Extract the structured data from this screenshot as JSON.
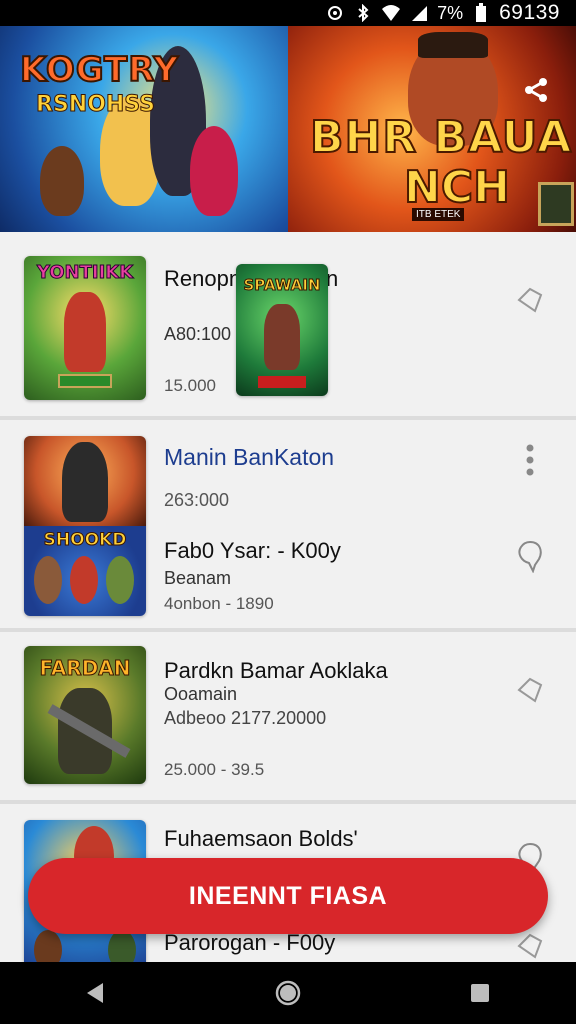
{
  "status_bar": {
    "battery_pct": "7%",
    "time": "69139",
    "icons": [
      "nfc-icon",
      "bluetooth-icon",
      "wifi-icon",
      "signal-icon",
      "battery-icon"
    ]
  },
  "banner": {
    "left_title": "KOGTRY",
    "left_subtitle": "RSNOHSS",
    "right_title": "BHR BAUA",
    "right_subtitle": "NCH",
    "right_tag": "ITB ETEK",
    "share_icon": "share-icon"
  },
  "items": [
    {
      "title": "Renopn Asromis",
      "overlay_suffix": "n",
      "sub": "A80:100",
      "meta": "15.000",
      "thumb_label": "YONTIIKK",
      "overlay_label": "SPAWAIN",
      "side_icon": "pin-icon"
    },
    {
      "title": "Manin BanKaton",
      "sub": "263:000",
      "title2": "Fab0 Ysar: - K00y",
      "sub2": "Beanam",
      "meta": "4onbon - 1890",
      "thumb_label": "SHOOKD",
      "side_icon_top": "more-vert-icon",
      "side_icon": "comment-icon"
    },
    {
      "title": "Pardkn Bamar Aoklaka",
      "sub": "Ooamain",
      "sub2": "Adbeoo 2177.20000",
      "meta": "25.000 - 39.5",
      "thumb_label": "FARDAN",
      "side_icon": "pin-icon"
    },
    {
      "title": "Fuhaemsaon Bolds'",
      "title2": "Parorogan - F00y",
      "side_icon": "comment-icon",
      "side_icon2": "pin-icon"
    }
  ],
  "fab_label": "INEENNT FIASA",
  "nav": [
    "back-icon",
    "home-icon",
    "recents-icon"
  ],
  "colors": {
    "accent": "#d8262a",
    "title_blue": "#1d3d8f"
  }
}
